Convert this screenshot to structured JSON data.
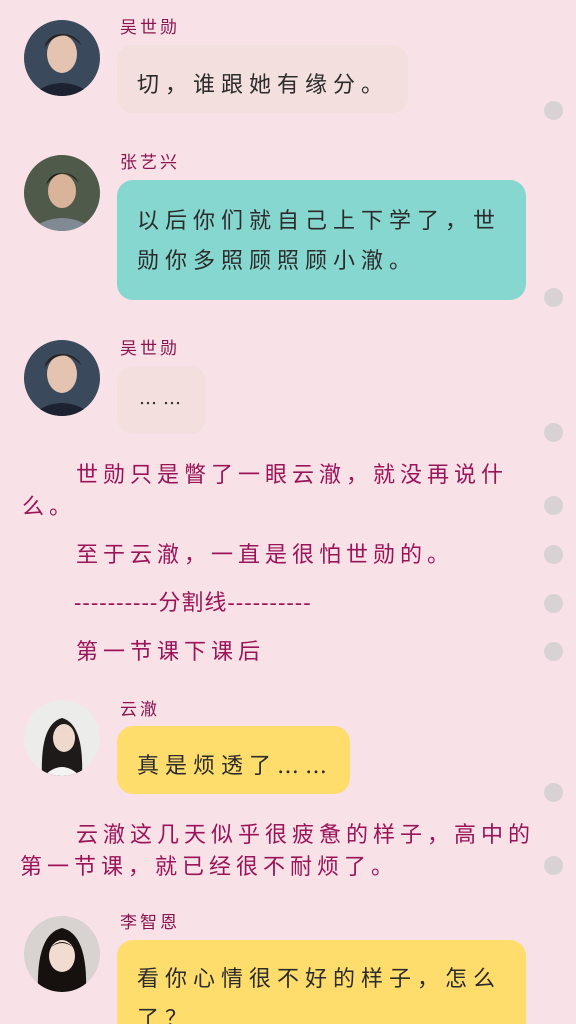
{
  "colors": {
    "background": "#f9e1e8",
    "bubble_beige": "#f3dfdd",
    "bubble_teal": "#86d7cf",
    "bubble_yellow": "#fedd6c",
    "name_color": "#8a1650",
    "narration_color": "#9a1458"
  },
  "messages": [
    {
      "sender": "吴世勋",
      "text": "切，谁跟她有缘分。"
    },
    {
      "sender": "张艺兴",
      "text": "以后你们就自己上下学了，世勋你多照顾照顾小澈。"
    },
    {
      "sender": "吴世勋",
      "text": "……"
    },
    {
      "sender": "云澈",
      "text": "真是烦透了……"
    },
    {
      "sender": "李智恩",
      "text": "看你心情很不好的样子，怎么了？"
    }
  ],
  "narration": {
    "p1": "世勋只是瞥了一眼云澈，就没再说什么。",
    "p2": "至于云澈，一直是很怕世勋的。",
    "divider": "----------分割线----------",
    "p3": "第一节课下课后",
    "p4": "云澈这几天似乎很疲惫的样子，高中的第一节课，就已经很不耐烦了。"
  }
}
